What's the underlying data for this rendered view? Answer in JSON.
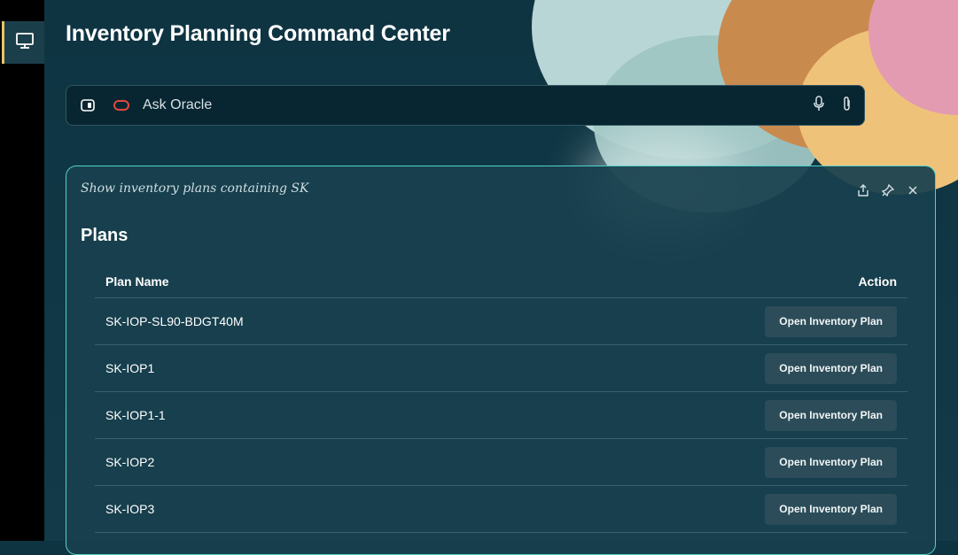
{
  "header": {
    "title": "Inventory Planning Command Center"
  },
  "search": {
    "placeholder": "Ask Oracle"
  },
  "panel": {
    "query": "Show inventory plans containing SK",
    "section_title": "Plans",
    "columns": {
      "plan_name": "Plan Name",
      "action": "Action"
    },
    "rows": [
      {
        "plan_name": "SK-IOP-SL90-BDGT40M",
        "action": "Open Inventory Plan"
      },
      {
        "plan_name": "SK-IOP1",
        "action": "Open Inventory Plan"
      },
      {
        "plan_name": "SK-IOP1-1",
        "action": "Open Inventory Plan"
      },
      {
        "plan_name": "SK-IOP2",
        "action": "Open Inventory Plan"
      },
      {
        "plan_name": "SK-IOP3",
        "action": "Open Inventory Plan"
      }
    ]
  },
  "icons": {
    "rail": "monitor-icon",
    "toggle": "panel-toggle-icon",
    "brand": "oracle-logo-icon",
    "mic": "microphone-icon",
    "attach": "paperclip-icon",
    "share": "share-icon",
    "pin": "pin-icon",
    "close": "close-icon"
  },
  "colors": {
    "accent": "#54d0c9",
    "rail_highlight": "#e8c46a",
    "oracle_red": "#e4473d"
  }
}
